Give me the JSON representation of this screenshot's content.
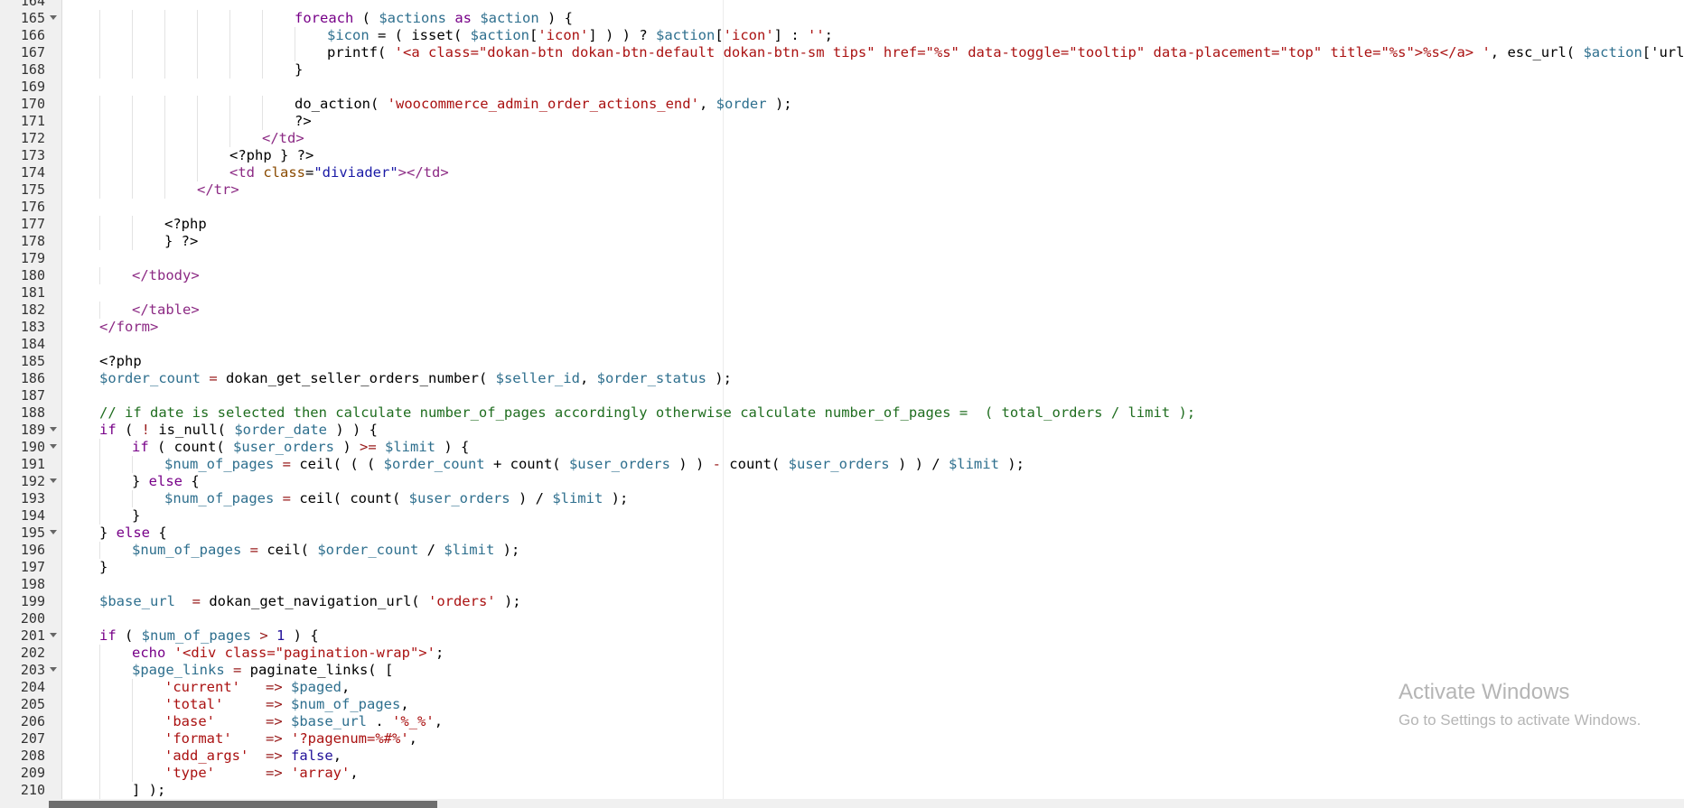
{
  "editor": {
    "lines": [
      {
        "n": "164",
        "fold": false,
        "indent": 0,
        "text": ""
      },
      {
        "n": "165",
        "fold": true,
        "indent": 6,
        "tokens": [
          [
            "k",
            "foreach"
          ],
          [
            "p",
            " ( "
          ],
          [
            "v",
            "$actions"
          ],
          [
            "p",
            " "
          ],
          [
            "k",
            "as"
          ],
          [
            "p",
            " "
          ],
          [
            "v",
            "$action"
          ],
          [
            "p",
            " ) {"
          ]
        ]
      },
      {
        "n": "166",
        "fold": false,
        "indent": 7,
        "tokens": [
          [
            "v",
            "$icon"
          ],
          [
            "p",
            " = ( isset( "
          ],
          [
            "v",
            "$action"
          ],
          [
            "p",
            "["
          ],
          [
            "s",
            "'icon'"
          ],
          [
            "p",
            "] ) ) ? "
          ],
          [
            "v",
            "$action"
          ],
          [
            "p",
            "["
          ],
          [
            "s",
            "'icon'"
          ],
          [
            "p",
            "] : "
          ],
          [
            "s",
            "''"
          ],
          [
            "p",
            ";"
          ]
        ]
      },
      {
        "n": "167",
        "fold": false,
        "indent": 7,
        "tokens": [
          [
            "p",
            "printf( "
          ],
          [
            "s",
            "'<a class=\"dokan-btn dokan-btn-default dokan-btn-sm tips\" href=\"%s\" data-toggle=\"tooltip\" data-placement=\"top\" title=\"%s\">%s</a> '"
          ],
          [
            "p",
            ", esc_url( "
          ],
          [
            "v",
            "$action"
          ],
          [
            "p",
            "['url"
          ]
        ]
      },
      {
        "n": "168",
        "fold": false,
        "indent": 6,
        "tokens": [
          [
            "p",
            "}"
          ]
        ]
      },
      {
        "n": "169",
        "fold": false,
        "indent": 0,
        "tokens": []
      },
      {
        "n": "170",
        "fold": false,
        "indent": 6,
        "tokens": [
          [
            "p",
            "do_action( "
          ],
          [
            "s",
            "'woocommerce_admin_order_actions_end'"
          ],
          [
            "p",
            ", "
          ],
          [
            "v",
            "$order"
          ],
          [
            "p",
            " );"
          ]
        ]
      },
      {
        "n": "171",
        "fold": false,
        "indent": 6,
        "tokens": [
          [
            "p",
            "?>"
          ]
        ]
      },
      {
        "n": "172",
        "fold": false,
        "indent": 5,
        "tokens": [
          [
            "tag",
            "</td>"
          ]
        ]
      },
      {
        "n": "173",
        "fold": false,
        "indent": 4,
        "tokens": [
          [
            "p",
            "<?php } ?>"
          ]
        ]
      },
      {
        "n": "174",
        "fold": false,
        "indent": 4,
        "tokens": [
          [
            "tag",
            "<td "
          ],
          [
            "at",
            "class"
          ],
          [
            "p",
            "="
          ],
          [
            "av",
            "\"diviader\""
          ],
          [
            "tag",
            "></td>"
          ]
        ]
      },
      {
        "n": "175",
        "fold": false,
        "indent": 3,
        "tokens": [
          [
            "tag",
            "</tr>"
          ]
        ]
      },
      {
        "n": "176",
        "fold": false,
        "indent": 0,
        "tokens": []
      },
      {
        "n": "177",
        "fold": false,
        "indent": 2,
        "tokens": [
          [
            "p",
            "<?php"
          ]
        ]
      },
      {
        "n": "178",
        "fold": false,
        "indent": 2,
        "tokens": [
          [
            "p",
            "} ?>"
          ]
        ]
      },
      {
        "n": "179",
        "fold": false,
        "indent": 0,
        "tokens": []
      },
      {
        "n": "180",
        "fold": false,
        "indent": 1,
        "tokens": [
          [
            "tag",
            "</tbody>"
          ]
        ]
      },
      {
        "n": "181",
        "fold": false,
        "indent": 0,
        "tokens": []
      },
      {
        "n": "182",
        "fold": false,
        "indent": 1,
        "tokens": [
          [
            "tag",
            "</table>"
          ]
        ]
      },
      {
        "n": "183",
        "fold": false,
        "indent": 0,
        "tokens": [
          [
            "tag",
            "</form>"
          ]
        ]
      },
      {
        "n": "184",
        "fold": false,
        "indent": 0,
        "tokens": []
      },
      {
        "n": "185",
        "fold": false,
        "indent": 0,
        "tokens": [
          [
            "p",
            "<?php"
          ]
        ]
      },
      {
        "n": "186",
        "fold": false,
        "indent": 0,
        "tokens": [
          [
            "v",
            "$order_count"
          ],
          [
            "o",
            " = "
          ],
          [
            "p",
            "dokan_get_seller_orders_number( "
          ],
          [
            "v",
            "$seller_id"
          ],
          [
            "p",
            ", "
          ],
          [
            "v",
            "$order_status"
          ],
          [
            "p",
            " );"
          ]
        ]
      },
      {
        "n": "187",
        "fold": false,
        "indent": 0,
        "tokens": []
      },
      {
        "n": "188",
        "fold": false,
        "indent": 0,
        "tokens": [
          [
            "c",
            "// if date is selected then calculate number_of_pages accordingly otherwise calculate number_of_pages =  ( total_orders / limit );"
          ]
        ]
      },
      {
        "n": "189",
        "fold": true,
        "indent": 0,
        "tokens": [
          [
            "k",
            "if"
          ],
          [
            "p",
            " ( "
          ],
          [
            "o",
            "!"
          ],
          [
            "p",
            " is_null( "
          ],
          [
            "v",
            "$order_date"
          ],
          [
            "p",
            " ) ) {"
          ]
        ]
      },
      {
        "n": "190",
        "fold": true,
        "indent": 1,
        "tokens": [
          [
            "k",
            "if"
          ],
          [
            "p",
            " ( count( "
          ],
          [
            "v",
            "$user_orders"
          ],
          [
            "p",
            " ) "
          ],
          [
            "o",
            ">="
          ],
          [
            "p",
            " "
          ],
          [
            "v",
            "$limit"
          ],
          [
            "p",
            " ) {"
          ]
        ]
      },
      {
        "n": "191",
        "fold": false,
        "indent": 2,
        "tokens": [
          [
            "v",
            "$num_of_pages"
          ],
          [
            "o",
            " = "
          ],
          [
            "p",
            "ceil( ( ( "
          ],
          [
            "v",
            "$order_count"
          ],
          [
            "p",
            " + count( "
          ],
          [
            "v",
            "$user_orders"
          ],
          [
            "p",
            " ) ) "
          ],
          [
            "o",
            "-"
          ],
          [
            "p",
            " count( "
          ],
          [
            "v",
            "$user_orders"
          ],
          [
            "p",
            " ) ) / "
          ],
          [
            "v",
            "$limit"
          ],
          [
            "p",
            " );"
          ]
        ]
      },
      {
        "n": "192",
        "fold": true,
        "indent": 1,
        "tokens": [
          [
            "p",
            "} "
          ],
          [
            "k",
            "else"
          ],
          [
            "p",
            " {"
          ]
        ]
      },
      {
        "n": "193",
        "fold": false,
        "indent": 2,
        "tokens": [
          [
            "v",
            "$num_of_pages"
          ],
          [
            "o",
            " = "
          ],
          [
            "p",
            "ceil( count( "
          ],
          [
            "v",
            "$user_orders"
          ],
          [
            "p",
            " ) / "
          ],
          [
            "v",
            "$limit"
          ],
          [
            "p",
            " );"
          ]
        ]
      },
      {
        "n": "194",
        "fold": false,
        "indent": 1,
        "tokens": [
          [
            "p",
            "}"
          ]
        ]
      },
      {
        "n": "195",
        "fold": true,
        "indent": 0,
        "tokens": [
          [
            "p",
            "} "
          ],
          [
            "k",
            "else"
          ],
          [
            "p",
            " {"
          ]
        ]
      },
      {
        "n": "196",
        "fold": false,
        "indent": 1,
        "tokens": [
          [
            "v",
            "$num_of_pages"
          ],
          [
            "o",
            " = "
          ],
          [
            "p",
            "ceil( "
          ],
          [
            "v",
            "$order_count"
          ],
          [
            "p",
            " / "
          ],
          [
            "v",
            "$limit"
          ],
          [
            "p",
            " );"
          ]
        ]
      },
      {
        "n": "197",
        "fold": false,
        "indent": 0,
        "tokens": [
          [
            "p",
            "}"
          ]
        ]
      },
      {
        "n": "198",
        "fold": false,
        "indent": 0,
        "tokens": []
      },
      {
        "n": "199",
        "fold": false,
        "indent": 0,
        "tokens": [
          [
            "v",
            "$base_url"
          ],
          [
            "p",
            "  "
          ],
          [
            "o",
            "="
          ],
          [
            "p",
            " dokan_get_navigation_url( "
          ],
          [
            "s",
            "'orders'"
          ],
          [
            "p",
            " );"
          ]
        ]
      },
      {
        "n": "200",
        "fold": false,
        "indent": 0,
        "tokens": []
      },
      {
        "n": "201",
        "fold": true,
        "indent": 0,
        "tokens": [
          [
            "k",
            "if"
          ],
          [
            "p",
            " ( "
          ],
          [
            "v",
            "$num_of_pages"
          ],
          [
            "o",
            " > "
          ],
          [
            "b",
            "1"
          ],
          [
            "p",
            " ) {"
          ]
        ]
      },
      {
        "n": "202",
        "fold": false,
        "indent": 1,
        "tokens": [
          [
            "k",
            "echo"
          ],
          [
            "p",
            " "
          ],
          [
            "s",
            "'<div class=\"pagination-wrap\">'"
          ],
          [
            "p",
            ";"
          ]
        ]
      },
      {
        "n": "203",
        "fold": true,
        "indent": 1,
        "tokens": [
          [
            "v",
            "$page_links"
          ],
          [
            "o",
            " = "
          ],
          [
            "p",
            "paginate_links( ["
          ]
        ]
      },
      {
        "n": "204",
        "fold": false,
        "indent": 2,
        "tokens": [
          [
            "s",
            "'current'"
          ],
          [
            "p",
            "   "
          ],
          [
            "o",
            "=>"
          ],
          [
            "p",
            " "
          ],
          [
            "v",
            "$paged"
          ],
          [
            "p",
            ","
          ]
        ]
      },
      {
        "n": "205",
        "fold": false,
        "indent": 2,
        "tokens": [
          [
            "s",
            "'total'"
          ],
          [
            "p",
            "     "
          ],
          [
            "o",
            "=>"
          ],
          [
            "p",
            " "
          ],
          [
            "v",
            "$num_of_pages"
          ],
          [
            "p",
            ","
          ]
        ]
      },
      {
        "n": "206",
        "fold": false,
        "indent": 2,
        "tokens": [
          [
            "s",
            "'base'"
          ],
          [
            "p",
            "      "
          ],
          [
            "o",
            "=>"
          ],
          [
            "p",
            " "
          ],
          [
            "v",
            "$base_url"
          ],
          [
            "p",
            " . "
          ],
          [
            "s",
            "'%_%'"
          ],
          [
            "p",
            ","
          ]
        ]
      },
      {
        "n": "207",
        "fold": false,
        "indent": 2,
        "tokens": [
          [
            "s",
            "'format'"
          ],
          [
            "p",
            "    "
          ],
          [
            "o",
            "=>"
          ],
          [
            "p",
            " "
          ],
          [
            "s",
            "'?pagenum=%#%'"
          ],
          [
            "p",
            ","
          ]
        ]
      },
      {
        "n": "208",
        "fold": false,
        "indent": 2,
        "tokens": [
          [
            "s",
            "'add_args'"
          ],
          [
            "p",
            "  "
          ],
          [
            "o",
            "=>"
          ],
          [
            "p",
            " "
          ],
          [
            "b",
            "false"
          ],
          [
            "p",
            ","
          ]
        ]
      },
      {
        "n": "209",
        "fold": false,
        "indent": 2,
        "tokens": [
          [
            "s",
            "'type'"
          ],
          [
            "p",
            "      "
          ],
          [
            "o",
            "=>"
          ],
          [
            "p",
            " "
          ],
          [
            "s",
            "'array'"
          ],
          [
            "p",
            ","
          ]
        ]
      },
      {
        "n": "210",
        "fold": false,
        "indent": 1,
        "tokens": [
          [
            "p",
            "] );"
          ]
        ]
      }
    ]
  },
  "watermark": {
    "title": "Activate Windows",
    "subtitle": "Go to Settings to activate Windows."
  }
}
